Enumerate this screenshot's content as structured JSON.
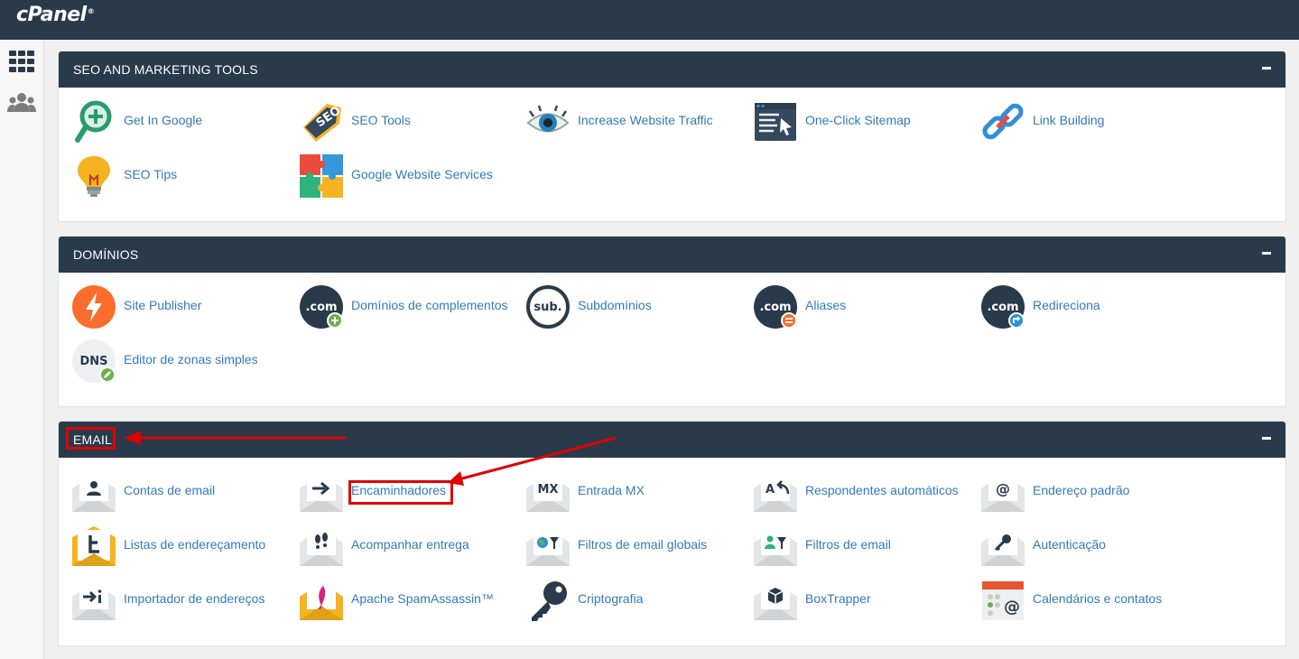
{
  "brand": {
    "logo": "cPanel",
    "mark": "®"
  },
  "sidebar": {
    "icons": [
      "apps-grid-icon",
      "users-icon"
    ]
  },
  "sections": [
    {
      "title": "SEO AND MARKETING TOOLS",
      "items": [
        {
          "label": "Get In Google",
          "icon": "search-plus-icon"
        },
        {
          "label": "SEO Tools",
          "icon": "seo-tag-icon"
        },
        {
          "label": "Increase Website Traffic",
          "icon": "eye-icon"
        },
        {
          "label": "One-Click Sitemap",
          "icon": "sitemap-icon"
        },
        {
          "label": "Link Building",
          "icon": "chain-link-icon"
        },
        {
          "label": "SEO Tips",
          "icon": "lightbulb-icon"
        },
        {
          "label": "Google Website Services",
          "icon": "puzzle-icon"
        }
      ]
    },
    {
      "title": "DOMÍNIOS",
      "items": [
        {
          "label": "Site Publisher",
          "icon": "lightning-icon"
        },
        {
          "label": "Domínios de complementos",
          "icon": "dotcom-add-icon",
          "icon_text": ".com"
        },
        {
          "label": "Subdomínios",
          "icon": "sub-domain-icon",
          "icon_text": "sub."
        },
        {
          "label": "Aliases",
          "icon": "dotcom-alias-icon",
          "icon_text": ".com"
        },
        {
          "label": "Redireciona",
          "icon": "dotcom-redirect-icon",
          "icon_text": ".com"
        },
        {
          "label": "Editor de zonas simples",
          "icon": "dns-edit-icon",
          "icon_text": "DNS"
        }
      ]
    },
    {
      "title": "EMAIL",
      "items": [
        {
          "label": "Contas de email",
          "icon": "envelope-user-icon"
        },
        {
          "label": "Encaminhadores",
          "icon": "envelope-arrow-icon"
        },
        {
          "label": "Entrada MX",
          "icon": "envelope-mx-icon",
          "icon_text": "MX"
        },
        {
          "label": "Respondentes automáticos",
          "icon": "envelope-reply-icon",
          "icon_text": "A"
        },
        {
          "label": "Endereço padrão",
          "icon": "envelope-at-icon",
          "icon_text": "@"
        },
        {
          "label": "Listas de endereçamento",
          "icon": "mailing-list-icon"
        },
        {
          "label": "Acompanhar entrega",
          "icon": "envelope-footprints-icon"
        },
        {
          "label": "Filtros de email globais",
          "icon": "envelope-globe-filter-icon"
        },
        {
          "label": "Filtros de email",
          "icon": "envelope-user-filter-icon"
        },
        {
          "label": "Autenticação",
          "icon": "envelope-key-icon"
        },
        {
          "label": "Importador de endereços",
          "icon": "envelope-import-icon"
        },
        {
          "label": "Apache SpamAssassin™",
          "icon": "envelope-feather-icon"
        },
        {
          "label": "Criptografia",
          "icon": "key-icon"
        },
        {
          "label": "BoxTrapper",
          "icon": "envelope-box-icon"
        },
        {
          "label": "Calendários e contatos",
          "icon": "calendar-contacts-icon",
          "icon_text": "@"
        }
      ]
    }
  ],
  "colors": {
    "header": "#293a4a",
    "link": "#337ab7",
    "highlight": "#e00000"
  }
}
